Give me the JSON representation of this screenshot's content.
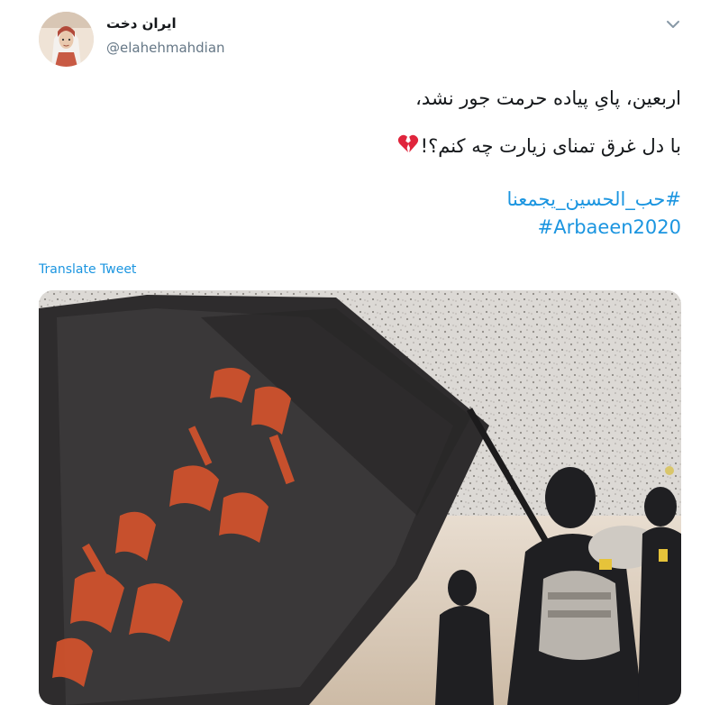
{
  "user": {
    "display_name": "ایران دخت",
    "handle": "@elahehmahdian"
  },
  "tweet": {
    "line1": "اربعین، پایِ پیاده حرمت جور نشد،",
    "line2": "با دل غرق تمنای زیارت چه کنم؟!",
    "emoji": "broken-heart-icon",
    "hashtags": [
      "#حب_الحسين_يجمعنا",
      "#Arbaeen2020"
    ]
  },
  "actions": {
    "translate": "Translate Tweet"
  },
  "colors": {
    "link": "#1b95e0",
    "secondary_text": "#657786",
    "primary_text": "#14171a",
    "broken_heart": "#e0253c"
  }
}
